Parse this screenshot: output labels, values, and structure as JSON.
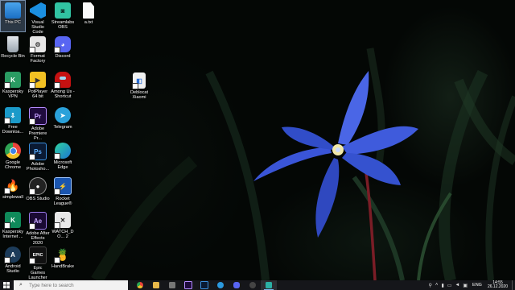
{
  "desktop_icons": [
    {
      "label": "This PC",
      "icon": "computer-icon"
    },
    {
      "label": "Visual Studio Code",
      "icon": "vscode-icon"
    },
    {
      "label": "Streamlabs OBS",
      "icon": "streamlabs-icon"
    },
    {
      "label": "a.txt",
      "icon": "text-file-icon"
    },
    {
      "label": "Recycle Bin",
      "icon": "recycle-bin-icon"
    },
    {
      "label": "Format Factory",
      "icon": "format-factory-icon"
    },
    {
      "label": "Discord",
      "icon": "discord-icon"
    },
    {
      "label": "Kaspersky VPN",
      "icon": "kaspersky-vpn-icon"
    },
    {
      "label": "PotPlayer 64 bit",
      "icon": "potplayer-icon"
    },
    {
      "label": "Among Us - Shortcut",
      "icon": "among-us-icon"
    },
    {
      "label": "Free Downloa...",
      "icon": "free-download-icon"
    },
    {
      "label": "Adobe Premiere Pr...",
      "icon": "premiere-icon"
    },
    {
      "label": "Telegram",
      "icon": "telegram-icon"
    },
    {
      "label": "Google Chrome",
      "icon": "chrome-icon"
    },
    {
      "label": "Adobe Photosho...",
      "icon": "photoshop-icon"
    },
    {
      "label": "Microsoft Edge",
      "icon": "edge-icon"
    },
    {
      "label": "simplewall",
      "icon": "simplewall-icon"
    },
    {
      "label": "OBS Studio",
      "icon": "obs-icon"
    },
    {
      "label": "Rocket League®",
      "icon": "rocket-league-icon"
    },
    {
      "label": "Kaspersky Internet ...",
      "icon": "kaspersky-icon"
    },
    {
      "label": "Adobe After Effects 2020",
      "icon": "after-effects-icon"
    },
    {
      "label": "WATCH_DO... 2",
      "icon": "watch-dogs-icon"
    },
    {
      "label": "Android Studio",
      "icon": "android-studio-icon"
    },
    {
      "label": "Epic Games Launcher",
      "icon": "epic-games-icon"
    },
    {
      "label": "HandBrake",
      "icon": "handbrake-icon"
    },
    {
      "label": "Deblocat Xiaomi",
      "icon": "folder-app-icon"
    }
  ],
  "taskbar": {
    "search_placeholder": "Type here to search",
    "apps": [
      {
        "name": "chrome",
        "icon": "chrome-icon",
        "color": "#e8453c"
      },
      {
        "name": "file-explorer",
        "icon": "folder-icon",
        "color": "#e8b84a"
      },
      {
        "name": "terminal",
        "icon": "terminal-icon",
        "color": "#777777"
      },
      {
        "name": "premiere",
        "icon": "premiere-icon",
        "color": "#1f0b3d"
      },
      {
        "name": "photoshop",
        "icon": "photoshop-icon",
        "color": "#0a1a33"
      },
      {
        "name": "edge",
        "icon": "edge-icon",
        "color": "#2b9ae0"
      },
      {
        "name": "discord",
        "icon": "discord-icon",
        "color": "#5865f2"
      },
      {
        "name": "obs",
        "icon": "obs-icon",
        "color": "#444444"
      },
      {
        "name": "active-app",
        "icon": "app-icon",
        "color": "#2bb0a5"
      }
    ],
    "language": "ENG",
    "time": "14:55",
    "date": "26.12.2020"
  },
  "colors": {
    "taskbar": "#15161a",
    "flower": "#3a55d8",
    "accent": "#7ab2e8"
  }
}
